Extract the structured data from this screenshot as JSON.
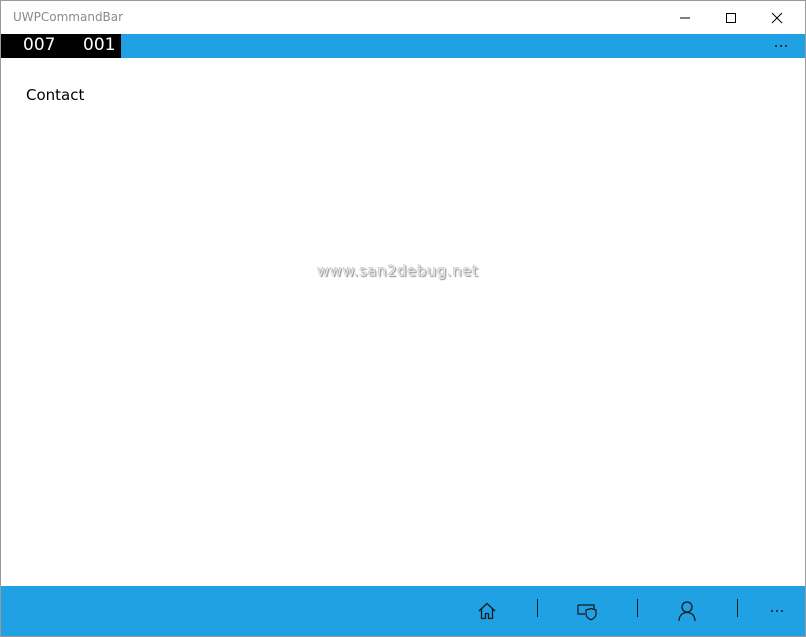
{
  "window": {
    "title": "UWPCommandBar",
    "controls": {
      "minimize": "minimize-icon",
      "maximize": "maximize-icon",
      "close": "close-icon"
    }
  },
  "top_bar": {
    "counter_left": "007",
    "counter_right": "001",
    "more_icon": "ellipsis-icon",
    "color": "#1fa1e3"
  },
  "content": {
    "text": "Contact",
    "watermark": "www.san2debug.net"
  },
  "bottom_bar": {
    "color": "#1fa1e3",
    "buttons": [
      {
        "icon": "home-icon"
      },
      {
        "icon": "shield-icon"
      },
      {
        "icon": "user-icon"
      },
      {
        "icon": "ellipsis-icon"
      }
    ]
  }
}
